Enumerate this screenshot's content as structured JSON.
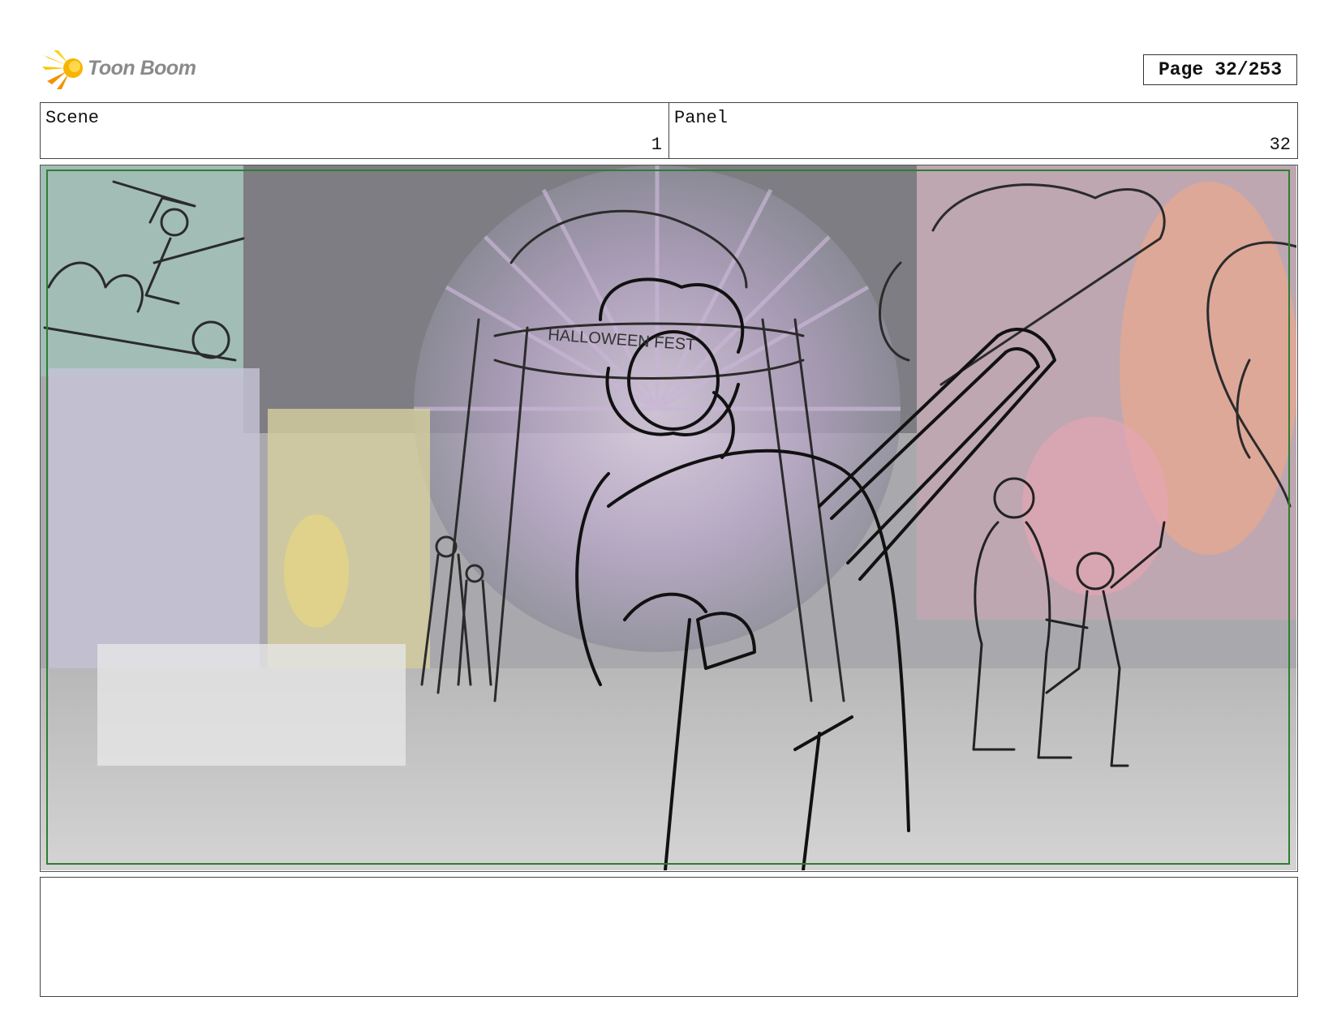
{
  "brand": {
    "name": "Toon Boom",
    "logo_colors": [
      "#f7c600",
      "#f39200"
    ]
  },
  "page": {
    "label": "Page",
    "value": "32/253"
  },
  "header": {
    "scene_label": "Scene",
    "scene_value": "1",
    "panel_label": "Panel",
    "panel_value": "32"
  },
  "panel": {
    "sign_text": "HALLOWEEN FEST",
    "safe_frame_color": "#2e7d32"
  },
  "notes": {
    "text": ""
  }
}
